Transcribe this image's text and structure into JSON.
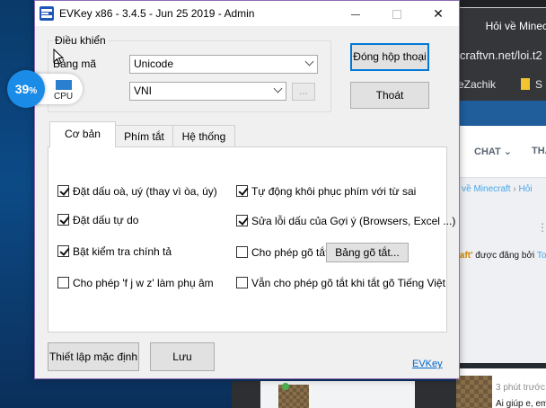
{
  "browser": {
    "tab_title": "Hỏi về Minecraft",
    "address": "craftvn.net/loi.t2",
    "bookmarks": [
      "eZachik",
      "S"
    ],
    "nav": {
      "chat": "CHAT",
      "other": "THA"
    },
    "breadcrumb": {
      "prefix": "về Minecraft",
      "current": "Hỏi"
    },
    "post": {
      "title_fragment": "raft'",
      "posted_by": "được đăng bởi",
      "author": "Ton"
    },
    "card": {
      "time": "3 phút trước",
      "snippet": "Ai giúp e, em có cài unikey"
    }
  },
  "cpu": {
    "value": "39",
    "unit": "%",
    "label": "CPU"
  },
  "window": {
    "title": "EVKey x86 - 3.4.5 - Jun 25 2019 - Admin",
    "min_icon": "minimize-icon",
    "max_icon": "maximize-icon",
    "close_icon": "close-icon",
    "close_glyph": "✕"
  },
  "settings": {
    "group_title": "Điều khiển",
    "encoding_label": "Bảng mã",
    "encoding_value": "Unicode",
    "typing_value": "VNI",
    "more_button": "..."
  },
  "actions": {
    "close_panel": "Đóng hộp thoại",
    "exit": "Thoát",
    "default": "Thiết lập mặc định",
    "save": "Lưu",
    "link": "EVKey"
  },
  "tabs": [
    {
      "label": "Cơ bản",
      "active": true
    },
    {
      "label": "Phím tắt",
      "active": false
    },
    {
      "label": "Hệ thống",
      "active": false
    }
  ],
  "options": {
    "left": [
      {
        "label": "Đặt dấu oà, uý (thay vì òa, úy)",
        "checked": true
      },
      {
        "label": "Đặt dấu tự do",
        "checked": true
      },
      {
        "label": "Bật kiểm tra chính tả",
        "checked": true
      },
      {
        "label": "Cho phép 'f j w z' làm phụ âm",
        "checked": false
      }
    ],
    "right": [
      {
        "label": "Tự động khôi phục phím với từ sai",
        "checked": true
      },
      {
        "label": "Sửa lỗi dấu của Gợi ý (Browsers, Excel ...)",
        "checked": true
      },
      {
        "label": "Cho phép gõ tắt",
        "checked": false
      },
      {
        "label": "Vẫn cho phép gõ tắt khi tắt gõ Tiếng Việt",
        "checked": false
      }
    ],
    "hotkey_table_button": "Bảng gõ tắt..."
  }
}
